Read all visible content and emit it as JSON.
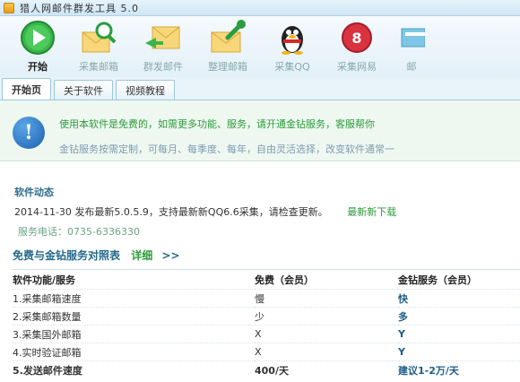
{
  "window": {
    "title": "猎人网邮件群发工具 5.0"
  },
  "toolbar": {
    "items": [
      {
        "label": "开始",
        "icon": "play-icon"
      },
      {
        "label": "采集邮箱",
        "icon": "magnifier-envelope-icon"
      },
      {
        "label": "群发邮件",
        "icon": "envelope-arrow-icon"
      },
      {
        "label": "整理邮箱",
        "icon": "wrench-envelope-icon"
      },
      {
        "label": "采集QQ",
        "icon": "qq-penguin-icon"
      },
      {
        "label": "采集网易",
        "icon": "netease-icon"
      },
      {
        "label": "邮",
        "icon": "more-icon"
      }
    ]
  },
  "tabs": [
    {
      "label": "开始页"
    },
    {
      "label": "关于软件"
    },
    {
      "label": "视频教程"
    }
  ],
  "notice": {
    "main": "使用本软件是免费的，如需更多功能、服务，请开通金钻服务，客服帮你",
    "sub": "金钻服务按需定制，可每月、每季度、每年，自由灵活选择，改变软件通常一"
  },
  "news": {
    "title": "软件动态",
    "date": "2014-11-30",
    "text": "发布最新5.0.5.9，支持最新新QQ6.6采集，请检查更新。",
    "download": "最新新下载",
    "phone": "服务电话：0735-6336330"
  },
  "compare": {
    "title": "免费与金钻服务对照表",
    "more": "详细",
    "arrow": ">>",
    "headers": [
      "软件功能/服务",
      "免费（会员）",
      "金钻服务（会员）"
    ],
    "rows": [
      [
        "1.采集邮箱速度",
        "慢",
        "快"
      ],
      [
        "2.采集邮箱数量",
        "少",
        "多"
      ],
      [
        "3.采集国外邮箱",
        "X",
        "Y"
      ],
      [
        "4.实时验证邮箱",
        "X",
        "Y"
      ],
      [
        "5.发送邮件速度",
        "400/天",
        "建议1-2万/天"
      ]
    ]
  }
}
